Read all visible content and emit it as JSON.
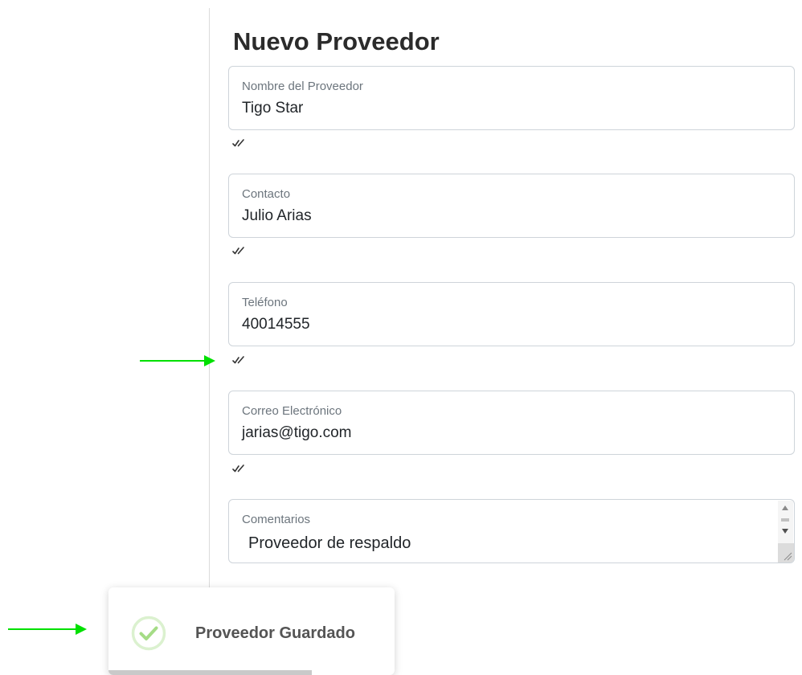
{
  "form": {
    "title": "Nuevo Proveedor",
    "fields": [
      {
        "label": "Nombre del Proveedor",
        "value": "Tigo Star"
      },
      {
        "label": "Contacto",
        "value": "Julio Arias"
      },
      {
        "label": "Teléfono",
        "value": "40014555"
      },
      {
        "label": "Correo Electrónico",
        "value": "jarias@tigo.com"
      }
    ],
    "comments": {
      "label": "Comentarios",
      "value": "Proveedor de respaldo"
    }
  },
  "validation": {
    "icon": "double-check-icon"
  },
  "annotations": {
    "arrow_color": "#00e000"
  },
  "toast": {
    "message": "Proveedor Guardado",
    "icon": "success-check-icon",
    "accent_color": "#a5dc86",
    "progress": 0.71
  }
}
